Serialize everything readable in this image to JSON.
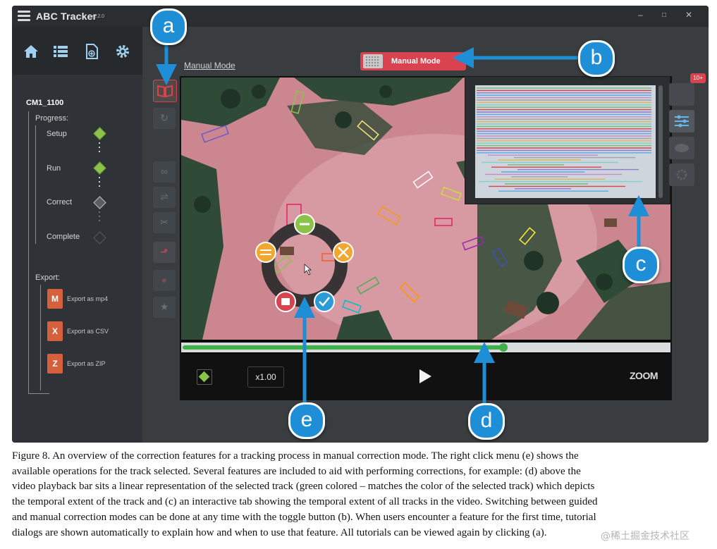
{
  "app": {
    "title": "ABC Tracker",
    "version": "v2.2.0",
    "window_controls": {
      "minimize": "–",
      "maximize": "□",
      "close": "✕"
    }
  },
  "sidebar": {
    "top_icons": [
      "home-icon",
      "list-icon",
      "add-file-icon",
      "gear-icon"
    ],
    "project_name": "CM1_1100",
    "progress_label": "Progress:",
    "steps": [
      {
        "label": "Setup",
        "state": "done"
      },
      {
        "label": "Run",
        "state": "done"
      },
      {
        "label": "Correct",
        "state": "current"
      },
      {
        "label": "Complete",
        "state": "pending"
      }
    ],
    "export_label": "Export:",
    "exports": [
      {
        "label": "Export as mp4",
        "icon": "M"
      },
      {
        "label": "Export as CSV",
        "icon": "X"
      },
      {
        "label": "Export as ZIP",
        "icon": "Z"
      }
    ]
  },
  "main": {
    "mode_link": "Manual Mode",
    "mode_toggle_label": "Manual Mode",
    "speed": "x1.00",
    "zoom_label": "ZOOM",
    "play_icon": "play-icon",
    "tracks_badge": "10+",
    "timeline_progress": 0.66
  },
  "callouts": [
    "a",
    "b",
    "c",
    "d",
    "e"
  ],
  "colors": {
    "accent_red": "#d9424f",
    "track_green": "#3fb04a",
    "callout_blue": "#1e8fd6",
    "sidebar": "#2f3337"
  },
  "caption": {
    "lines": [
      "Figure 8.   An overview of the correction features for a tracking process in manual correction mode. The right click menu (e) shows the",
      "available operations for the track selected. Several features are included to aid with performing corrections, for example: (d) above the",
      "video playback bar sits a linear representation of the selected track (green colored – matches the color of the selected track) which depicts",
      "the temporal extent of the track and (c) an interactive tab showing the temporal extent of all tracks in the video. Switching between guided",
      "and manual correction modes can be done at any time with the toggle button (b). When users encounter a feature for the first time, tutorial",
      "dialogs are shown automatically to explain how and when to use that feature. All tutorials can be viewed again by clicking (a)."
    ]
  },
  "watermark": "@稀土掘金技术社区"
}
